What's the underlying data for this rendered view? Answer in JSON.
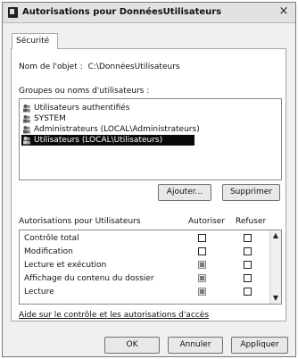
{
  "window": {
    "title": "Autorisations pour DonnéesUtilisateurs",
    "close_glyph": "×"
  },
  "tabs": [
    {
      "label": "Sécurité",
      "active": true
    }
  ],
  "object": {
    "label": "Nom de l'objet :",
    "value": "C:\\DonnéesUtilisateurs"
  },
  "groups": {
    "label": "Groupes ou noms d'utilisateurs :",
    "items": [
      {
        "label": "Utilisateurs authentifiés",
        "selected": false
      },
      {
        "label": "SYSTEM",
        "selected": false
      },
      {
        "label": "Administrateurs (LOCAL\\Administrateurs)",
        "selected": false
      },
      {
        "label": "Utilisateurs (LOCAL\\Utilisateurs)",
        "selected": true
      }
    ],
    "add_button": "Ajouter...",
    "remove_button": "Supprimer"
  },
  "permissions": {
    "header_label": "Autorisations pour Utilisateurs",
    "allow_label": "Autoriser",
    "deny_label": "Refuser",
    "rows": [
      {
        "label": "Contrôle total",
        "allow": false,
        "deny": false
      },
      {
        "label": "Modification",
        "allow": false,
        "deny": false
      },
      {
        "label": "Lecture et exécution",
        "allow": true,
        "deny": false
      },
      {
        "label": "Affichage du contenu du dossier",
        "allow": true,
        "deny": false
      },
      {
        "label": "Lecture",
        "allow": true,
        "deny": false
      }
    ]
  },
  "help_link": "Aide sur le contrôle et les autorisations d'accès",
  "footer": {
    "ok": "OK",
    "cancel": "Annuler",
    "apply": "Appliquer"
  }
}
